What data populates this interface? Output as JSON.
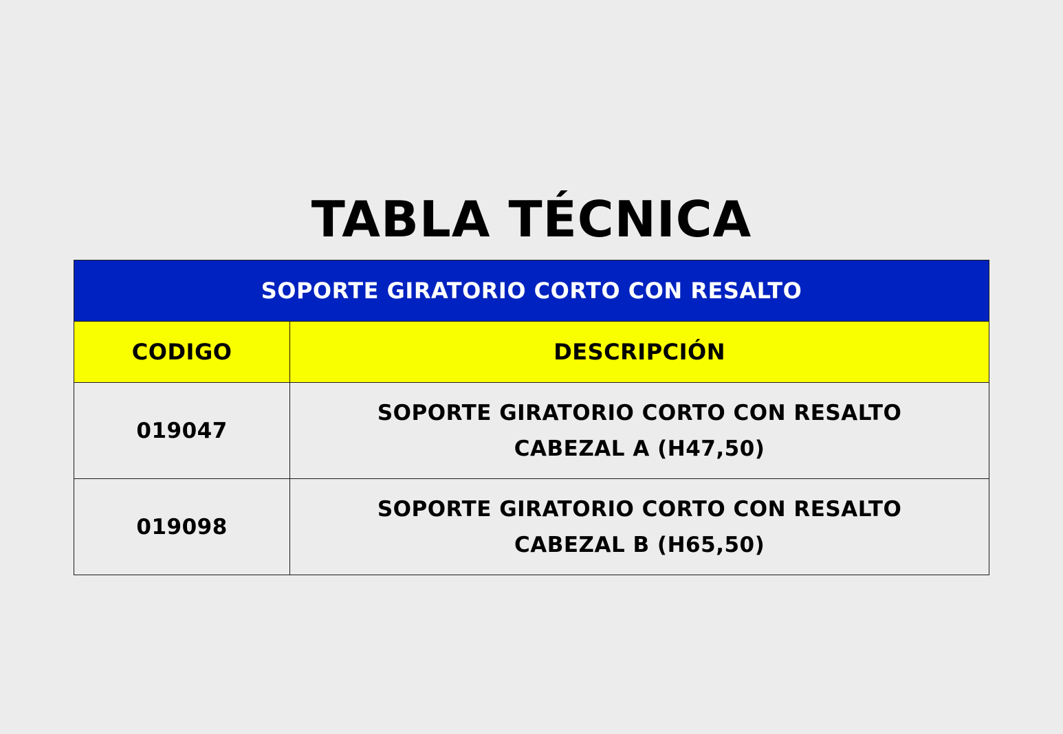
{
  "page": {
    "title": "TABLA TÉCNICA",
    "background_color": "#ececec"
  },
  "table": {
    "banner": "SOPORTE GIRATORIO CORTO CON RESALTO",
    "banner_color": "#0022c0",
    "header_color": "#faff00",
    "headers": {
      "code": "CODIGO",
      "description": "DESCRIPCIÓN"
    },
    "rows": [
      {
        "code": "019047",
        "description_line1": "SOPORTE GIRATORIO CORTO CON RESALTO",
        "description_line2": "CABEZAL A (H47,50)"
      },
      {
        "code": "019098",
        "description_line1": "SOPORTE GIRATORIO CORTO CON RESALTO",
        "description_line2": "CABEZAL B (H65,50)"
      }
    ]
  }
}
